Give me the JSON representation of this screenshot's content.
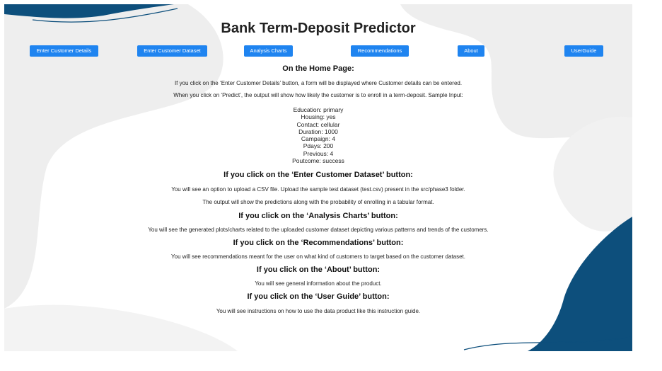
{
  "app": {
    "title": "Bank Term-Deposit Predictor"
  },
  "nav": {
    "items": [
      {
        "label": "Enter Customer Details"
      },
      {
        "label": "Enter Customer Dataset"
      },
      {
        "label": "Analysis Charts"
      },
      {
        "label": "Recommendations"
      },
      {
        "label": "About"
      },
      {
        "label": "UserGuide"
      }
    ]
  },
  "home": {
    "heading": "On the Home Page:",
    "line1": "If you click on the ‘Enter Customer Details’ button, a form will be displayed where Customer details can be entered.",
    "line2": "When you click on ‘Predict’, the output will show how likely the customer is to enroll in a term-deposit. Sample Input:",
    "sample_input": [
      "Education: primary",
      "Housing: yes",
      "Contact: cellular",
      "Duration: 1000",
      "Campaign: 4",
      "Pdays: 200",
      "Previous: 4",
      "Poutcome: success"
    ]
  },
  "dataset_section": {
    "heading": "If you click on the ‘Enter Customer Dataset’ button:",
    "line1": "You will see an option to upload a CSV file. Upload the sample test dataset (test.csv) present in the src/phase3 folder.",
    "line2": "The output will show the predictions along with the probability of enrolling in a tabular format."
  },
  "charts_section": {
    "heading": "If you click on the ‘Analysis Charts’ button:",
    "line1": "You will see the generated plots/charts related to the uploaded customer dataset depicting various patterns and trends of the customers."
  },
  "recommendations_section": {
    "heading": "If you click on the ‘Recommendations’ button:",
    "line1": "You will see recommendations meant for the user on what kind of customers to target based on the customer dataset."
  },
  "about_section": {
    "heading": "If you click on the ‘About’ button:",
    "line1": "You will see general information about the product."
  },
  "userguide_section": {
    "heading": "If you click on the ‘User Guide’ button:",
    "line1": "You will see instructions on how to use the data product like this instruction guide."
  },
  "colors": {
    "button_bg": "#1f84f0",
    "button_text": "#ffffff",
    "wave_dark": "#0d4f7c",
    "wave_light": "#eeeeee"
  }
}
